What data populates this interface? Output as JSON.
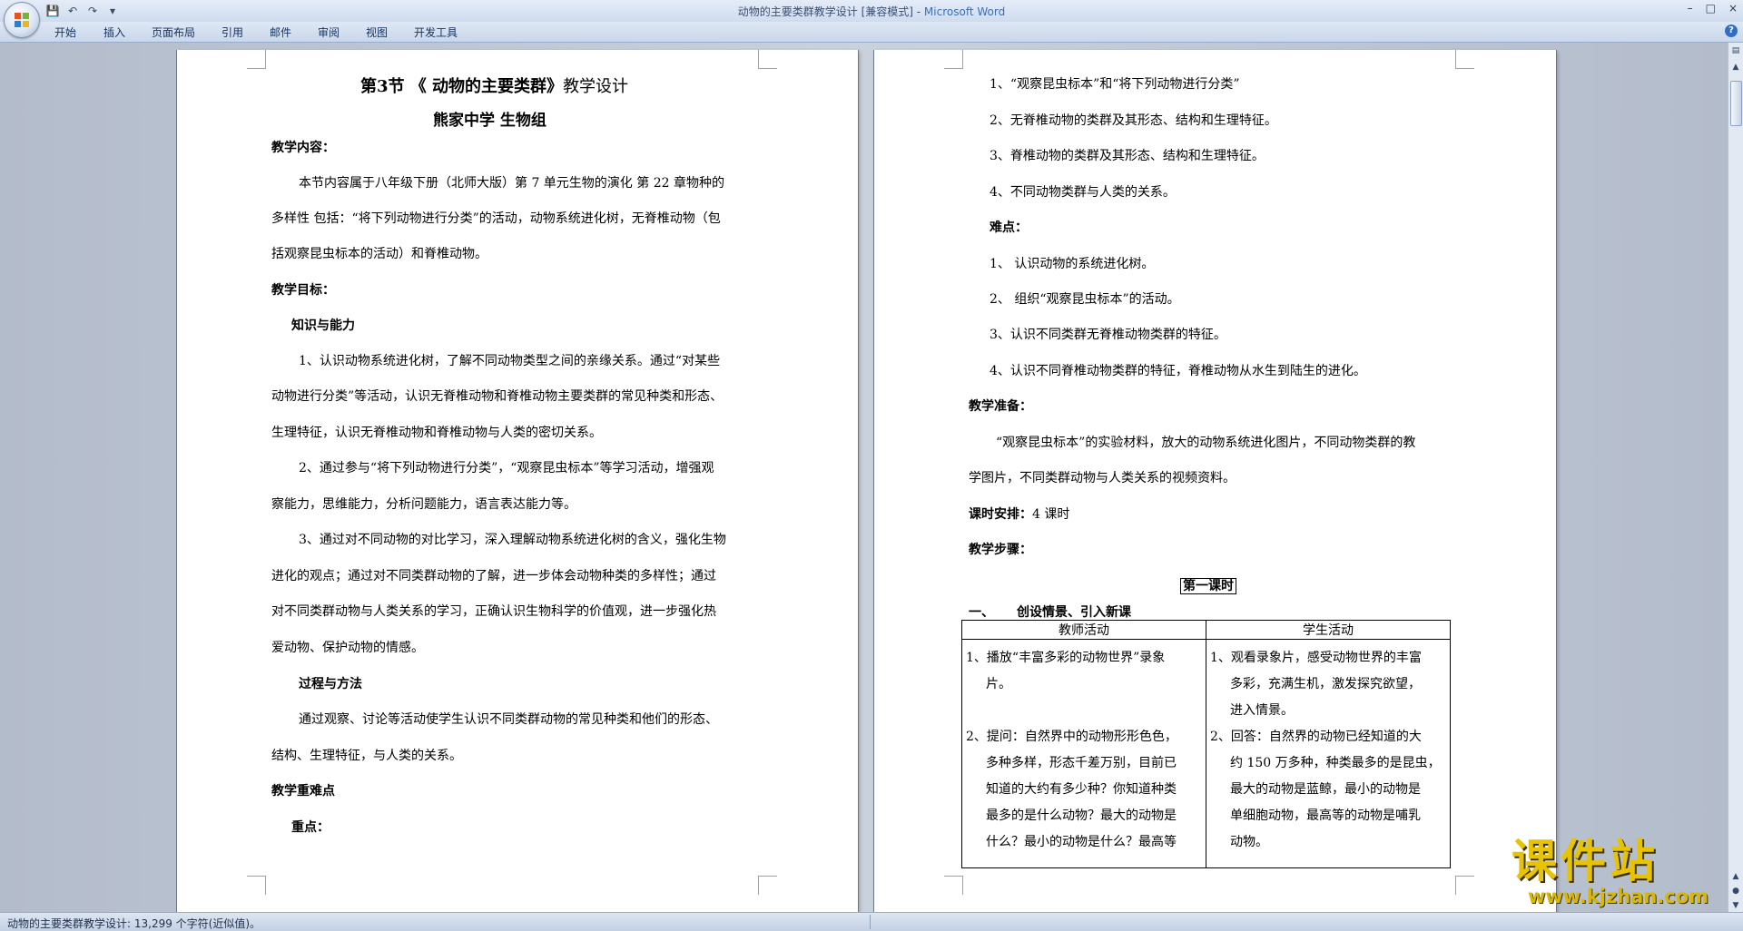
{
  "window": {
    "title": "动物的主要类群教学设计 [兼容模式] - ",
    "app_name": "Microsoft Word",
    "controls": [
      "–",
      "□",
      "×"
    ]
  },
  "quick_access": {
    "items": [
      "save-icon",
      "undo-icon",
      "redo-icon",
      "customize-icon"
    ],
    "glyphs": [
      "💾",
      "↶",
      "↷",
      "▾"
    ]
  },
  "ribbon": {
    "tabs": [
      "开始",
      "插入",
      "页面布局",
      "引用",
      "邮件",
      "审阅",
      "视图",
      "开发工具"
    ]
  },
  "page1": {
    "title_bold": "第3节 《 动物的主要类群》",
    "title_rest": "教学设计",
    "school": "熊家中学 生物组",
    "lines": [
      "教学内容：",
      "本节内容属于八年级下册（北师大版）第 7 单元生物的演化 第 22 章物种的",
      "多样性 包括：“将下列动物进行分类”的活动，动物系统进化树，无脊椎动物（包",
      "括观察昆虫标本的活动）和脊椎动物。",
      "教学目标：",
      "知识与能力",
      "1、认识动物系统进化树，了解不同动物类型之间的亲缘关系。通过“对某些",
      "动物进行分类”等活动，认识无脊椎动物和脊椎动物主要类群的常见种类和形态、",
      "生理特征，认识无脊椎动物和脊椎动物与人类的密切关系。",
      "2、通过参与“将下列动物进行分类”，“观察昆虫标本”等学习活动，增强观",
      "察能力，思维能力，分析问题能力，语言表达能力等。",
      "3、通过对不同动物的对比学习，深入理解动物系统进化树的含义，强化生物",
      "进化的观点；通过对不同类群动物的了解，进一步体会动物种类的多样性；通过",
      "对不同类群动物与人类关系的学习，正确认识生物科学的价值观，进一步强化热",
      "爱动物、保护动物的情感。",
      "过程与方法",
      "通过观察、讨论等活动使学生认识不同类群动物的常见种类和他们的形态、",
      "结构、生理特征，与人类的关系。",
      "教学重难点",
      "重点："
    ]
  },
  "page2": {
    "lines": [
      "1、“观察昆虫标本”和“将下列动物进行分类”",
      "2、无脊椎动物的类群及其形态、结构和生理特征。",
      "3、脊椎动物的类群及其形态、结构和生理特征。",
      "4、不同动物类群与人类的关系。",
      "难点：",
      "1、 认识动物的系统进化树。",
      "2、 组织“观察昆虫标本”的活动。",
      "3、认识不同类群无脊椎动物类群的特征。",
      "4、认识不同脊椎动物类群的特征，脊椎动物从水生到陆生的进化。",
      "教学准备：",
      "“观察昆虫标本”的实验材料，放大的动物系统进化图片，不同动物类群的教",
      "学图片，不同类群动物与人类关系的视频资料。",
      "课时安排：",
      "4 课时",
      "教学步骤：",
      "第一课时",
      "一、",
      "创设情景、引入新课"
    ],
    "table": {
      "headers": [
        "教师活动",
        "学生活动"
      ],
      "teacher": [
        "1、播放“丰富多彩的动物世界”录象",
        "片。",
        "",
        "2、提问：自然界中的动物形形色色，",
        "多种多样，形态千差万别，目前已",
        "知道的大约有多少种？你知道种类",
        "最多的是什么动物？最大的动物是",
        "什么？最小的动物是什么？最高等"
      ],
      "student": [
        "1、观看录象片，感受动物世界的丰富",
        "多彩，充满生机，激发探究欲望，",
        "进入情景。",
        "2、回答：自然界的动物已经知道的大",
        "约 150 万多种，种类最多的是昆虫，",
        "最大的动物是蓝鲸，最小的动物是",
        "单细胞动物，最高等的动物是哺乳",
        "动物。"
      ]
    }
  },
  "status": {
    "text": "动物的主要类群教学设计: 13,299 个字符(近似值)。"
  },
  "watermark": {
    "cn": "课件站",
    "url": "www.kjzhan.com"
  },
  "colors": {
    "accent": "#3b6fb6",
    "watermark": "#e8c400"
  }
}
